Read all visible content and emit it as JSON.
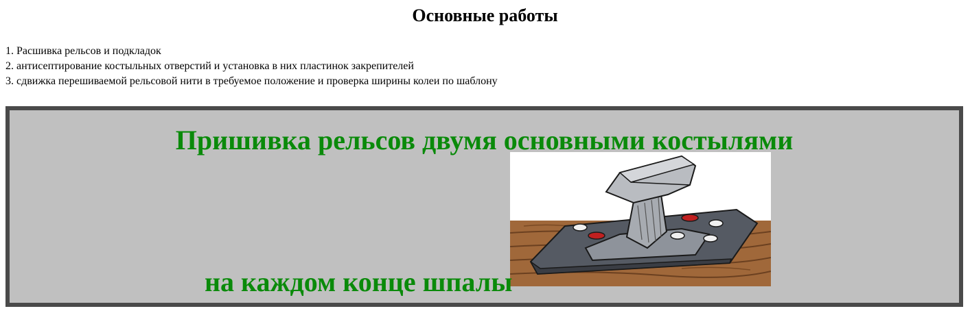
{
  "header": {
    "title": "Основные работы"
  },
  "works": {
    "items": [
      "1. Расшивка рельсов и подкладок",
      "2. антисептирование костыльных отверстий и установка в них пластинок закрепителей",
      "3. сдвижка перешиваемой рельсовой нити в требуемое положение и проверка ширины колеи по шаблону"
    ]
  },
  "panel": {
    "heading": "Пришивка рельсов двумя основными костылями",
    "caption": "на каждом конце шпалы",
    "illustration": "rail-spike-fastening-illustration",
    "heading_color": "#0a8a0a",
    "background_color": "#c0c0c0",
    "border_color": "#4a4a4a"
  }
}
